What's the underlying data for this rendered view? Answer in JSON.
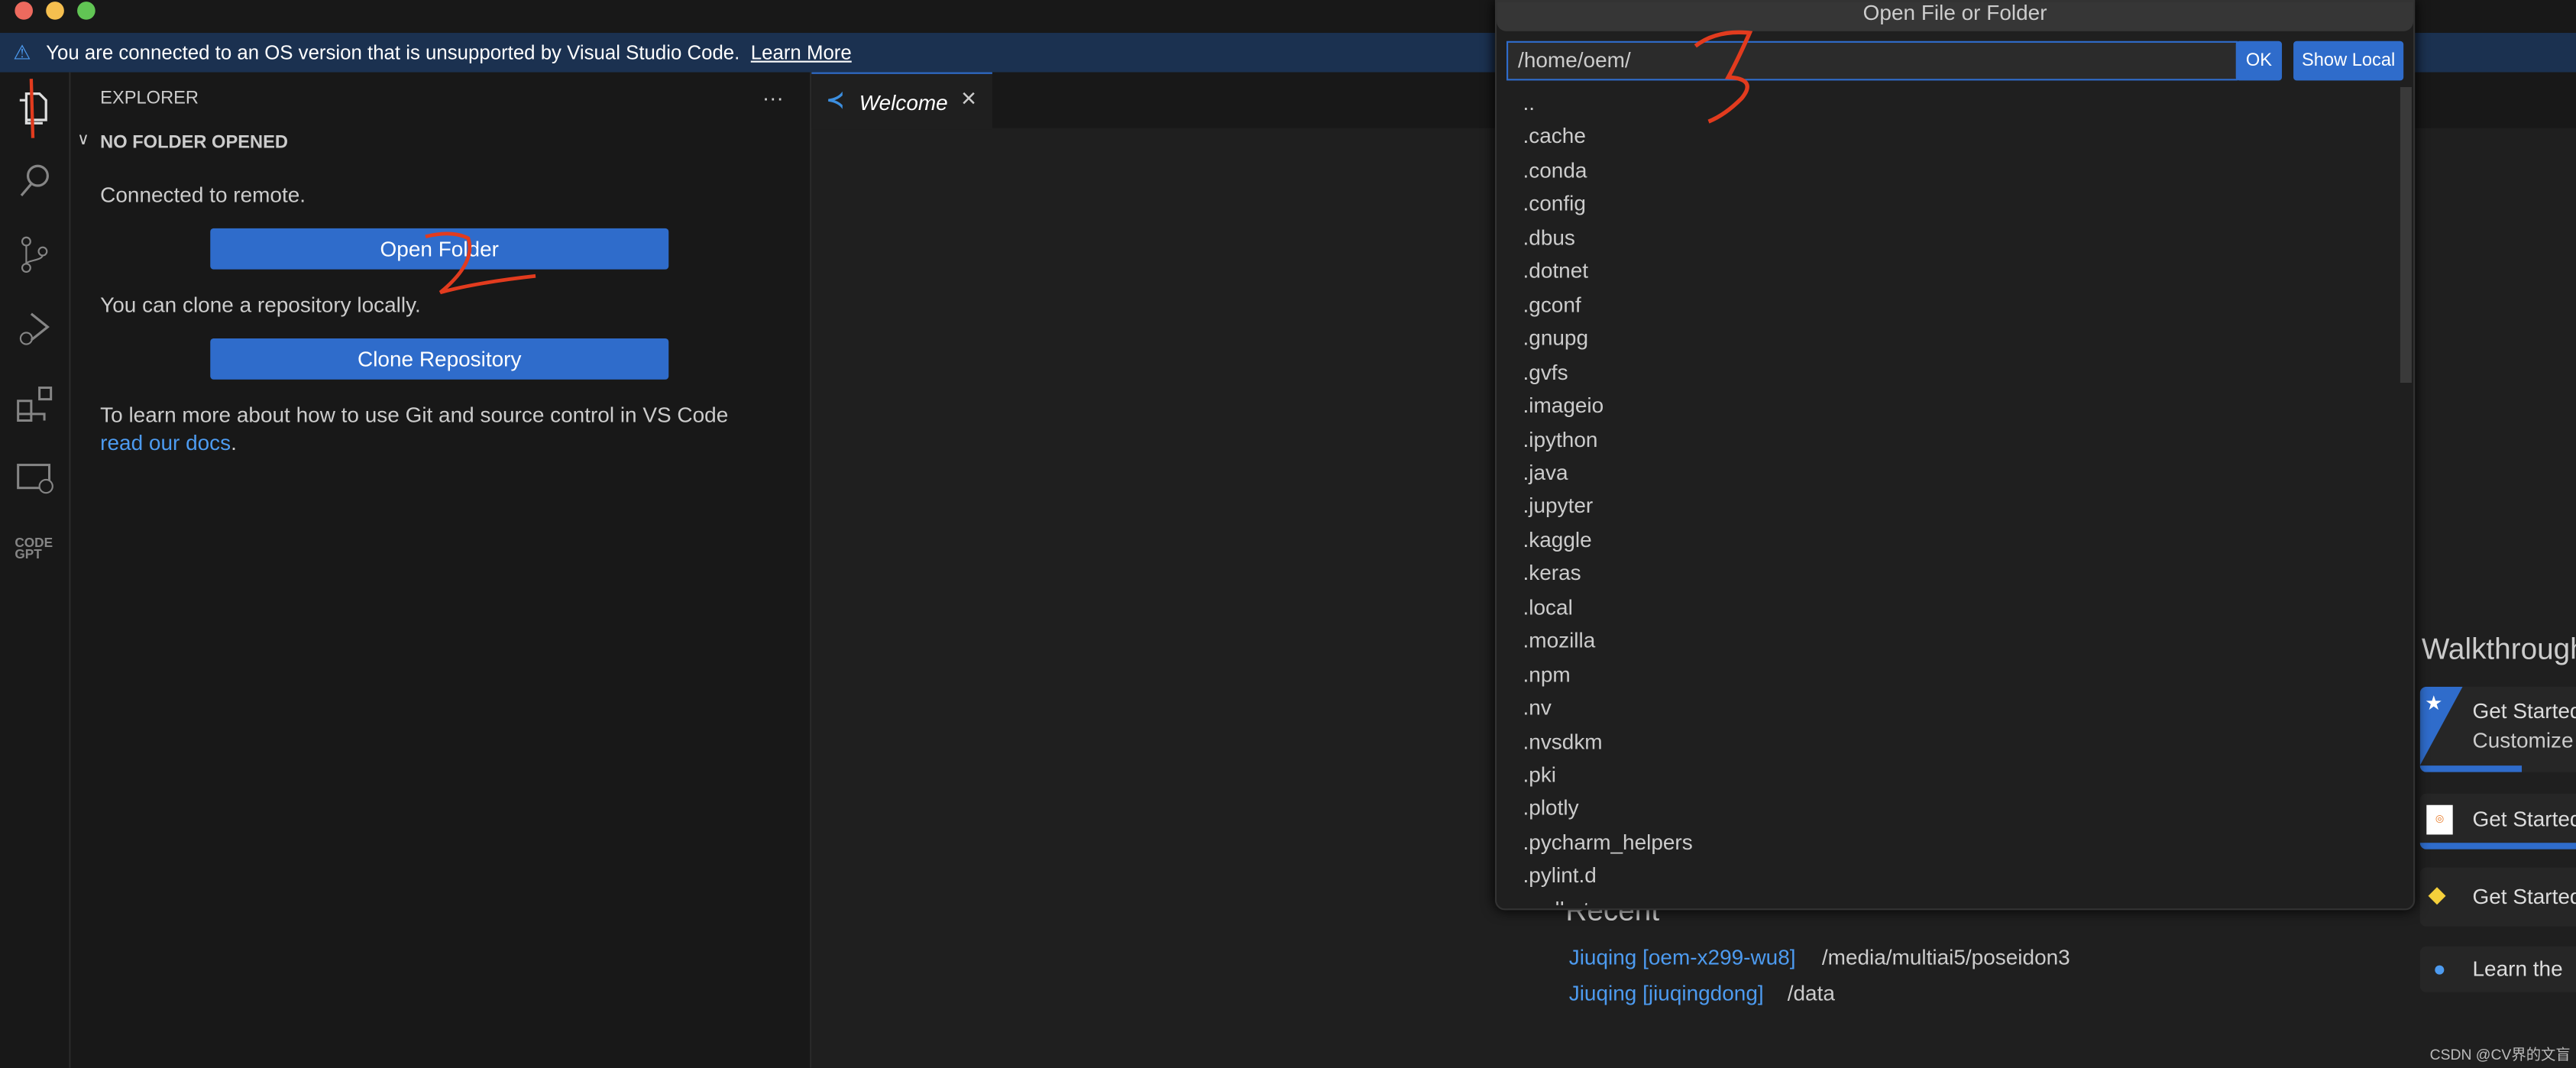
{
  "banner": {
    "message": "You are connected to an OS version that is unsupported by Visual Studio Code.",
    "link": "Learn More"
  },
  "explorer": {
    "title": "EXPLORER",
    "more": "···",
    "section": "NO FOLDER OPENED",
    "connected": "Connected to remote.",
    "open_folder": "Open Folder",
    "clone_text": "You can clone a repository locally.",
    "clone_button": "Clone Repository",
    "git_text": "To learn more about how to use Git and source control in VS Code ",
    "docs_link": "read our docs",
    "period": "."
  },
  "tab": {
    "label": "Welcome",
    "close": "×"
  },
  "dialog": {
    "title": "Open File or Folder",
    "path": "/home/oem/",
    "ok": "OK",
    "show_local": "Show Local",
    "items": [
      "..",
      ".cache",
      ".conda",
      ".config",
      ".dbus",
      ".dotnet",
      ".gconf",
      ".gnupg",
      ".gvfs",
      ".imageio",
      ".ipython",
      ".java",
      ".jupyter",
      ".kaggle",
      ".keras",
      ".local",
      ".mozilla",
      ".npm",
      ".nv",
      ".nvsdkm",
      ".pki",
      ".plotly",
      ".pycharm_helpers",
      ".pylint.d",
      ".redhat"
    ]
  },
  "recent": {
    "title": "Recent",
    "items": [
      {
        "name": "Jiuqing [oem-x299-wu8]",
        "path": "/media/multiai5/poseidon3"
      },
      {
        "name": "Jiuqing [jiuqingdong]",
        "path": "/data"
      }
    ]
  },
  "walkthroughs": {
    "title": "Walkthroughs",
    "items": [
      {
        "label": "Get Started",
        "sub": "Customize",
        "icon": "star-icon",
        "progress": 0.35
      },
      {
        "label": "Get Started",
        "icon": "jupyter-icon",
        "progress": 1.0
      },
      {
        "label": "Get Started",
        "icon": "python-icon"
      },
      {
        "label": "Learn the",
        "icon": "lightbulb-icon"
      }
    ]
  },
  "annotations": [
    "1",
    "2",
    "3"
  ],
  "watermark": "CSDN @CV界的文盲",
  "colors": {
    "accent": "#2f6ccb",
    "banner": "#1b3150",
    "link": "#4d9bf0",
    "annotation": "#e23b1e"
  }
}
